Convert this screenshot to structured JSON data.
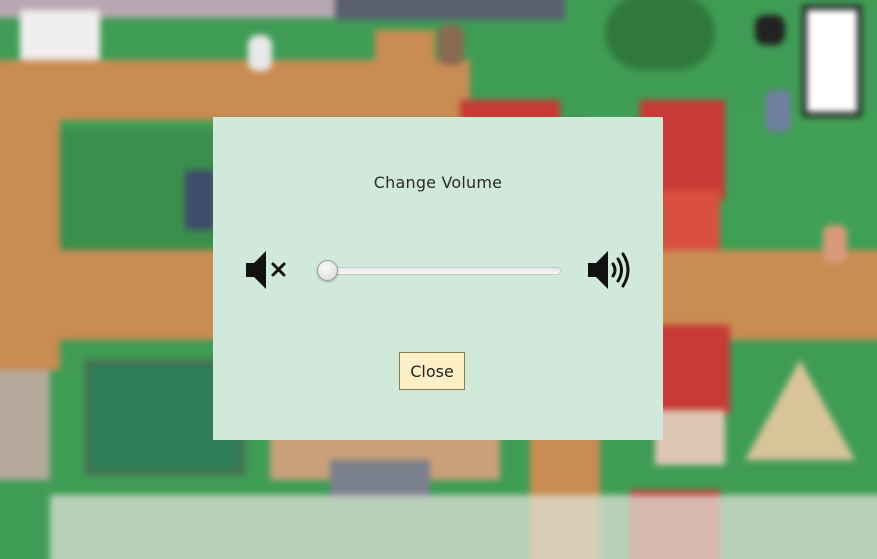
{
  "modal": {
    "title": "Change Volume",
    "close_label": "Close"
  },
  "volume": {
    "level": 0,
    "mute_icon": "volume-mute-icon",
    "max_icon": "volume-max-icon"
  },
  "colors": {
    "modal_bg": "#d1e9db",
    "button_bg": "#fdf0c6",
    "grass": "#3d9a52",
    "path": "#c88a52"
  }
}
